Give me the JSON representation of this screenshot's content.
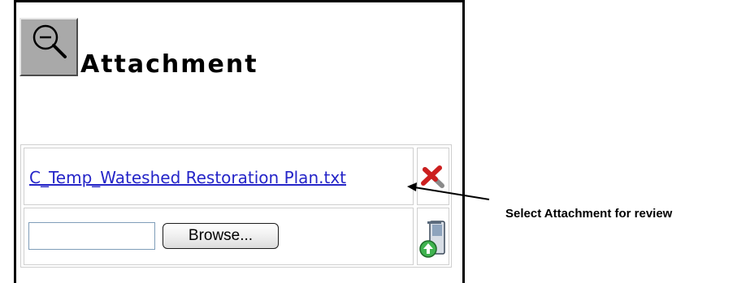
{
  "panel": {
    "title": "Attachment",
    "zoom_icon": "magnifier-zoom-out-icon"
  },
  "attachment": {
    "file_link": "C_Temp_Wateshed Restoration Plan.txt",
    "delete_icon": "red-x-delete-icon"
  },
  "upload": {
    "file_value": "",
    "browse_label": "Browse...",
    "upload_icon": "upload-document-icon"
  },
  "annotation": {
    "callout_text": "Select Attachment for review"
  },
  "colors": {
    "link": "#2525c8",
    "delete_icon": "#cc1f1f",
    "upload_arrow": "#3fb34f"
  }
}
